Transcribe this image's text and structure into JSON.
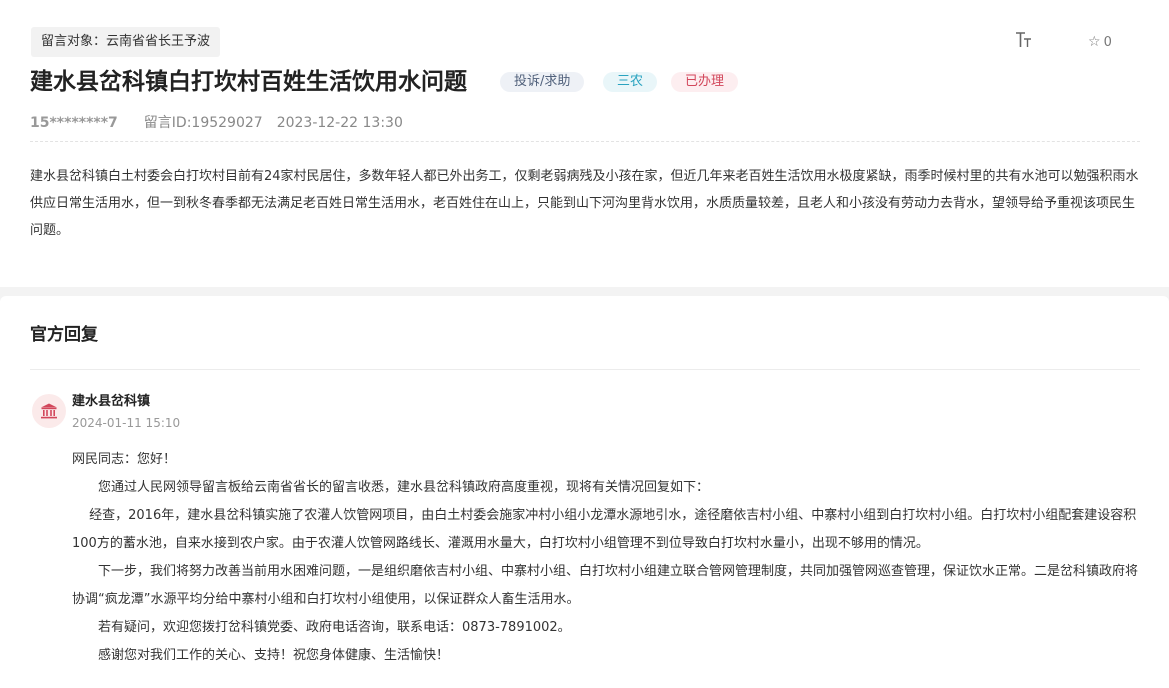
{
  "header": {
    "target_label": "留言对象：云南省省长王予波",
    "font_size_icon": "font-size-icon",
    "favorite_icon": "star-icon",
    "favorite_count": "0"
  },
  "message": {
    "title": "建水县岔科镇白打坎村百姓生活饮用水问题",
    "tags": [
      "投诉/求助",
      "三农",
      "已办理"
    ],
    "user": "15********7",
    "id_label": "留言ID:19529027",
    "datetime": "2023-12-22 13:30",
    "content": "建水县岔科镇白土村委会白打坎村目前有24家村民居住，多数年轻人都已外出务工，仅剩老弱病残及小孩在家，但近几年来老百姓生活饮用水极度紧缺，雨季时候村里的共有水池可以勉强积雨水供应日常生活用水，但一到秋冬春季都无法满足老百姓日常生活用水，老百姓住在山上，只能到山下河沟里背水饮用，水质质量较差，且老人和小孩没有劳动力去背水，望领导给予重视该项民生问题。"
  },
  "reply": {
    "section_title": "官方回复",
    "department": "建水县岔科镇",
    "datetime": "2024-01-11 15:10",
    "avatar_icon": "government-building-icon",
    "paragraphs": [
      "网民同志：您好！",
      "　　您通过人民网领导留言板给云南省省长的留言收悉，建水县岔科镇政府高度重视，现将有关情况回复如下：",
      "　 经查，2016年，建水县岔科镇实施了农灌人饮管网项目，由白土村委会施家冲村小组小龙潭水源地引水，途径磨依吉村小组、中寨村小组到白打坎村小组。白打坎村小组配套建设容积100方的蓄水池，自来水接到农户家。由于农灌人饮管网路线长、灌溉用水量大，白打坎村小组管理不到位导致白打坎村水量小，出现不够用的情况。",
      "　　下一步，我们将努力改善当前用水困难问题，一是组织磨依吉村小组、中寨村小组、白打坎村小组建立联合管网管理制度，共同加强管网巡查管理，保证饮水正常。二是岔科镇政府将协调“疯龙潭”水源平均分给中寨村小组和白打坎村小组使用，以保证群众人畜生活用水。",
      "　　若有疑问，欢迎您拨打岔科镇党委、政府电话咨询，联系电话：0873-7891002。",
      "　　感谢您对我们工作的关心、支持！祝您身体健康、生活愉快！"
    ]
  },
  "colors": {
    "tag_complaint": "#52627c",
    "tag_agri": "#2aa3c0",
    "tag_done": "#d2475b"
  }
}
